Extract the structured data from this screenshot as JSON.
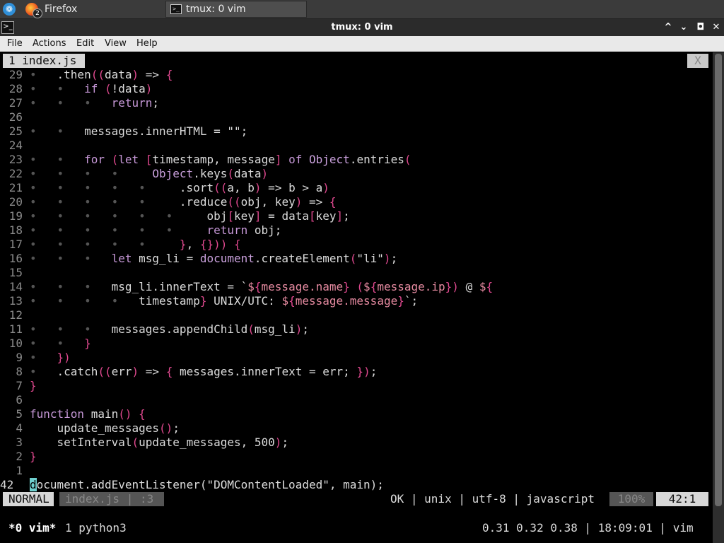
{
  "taskbar": {
    "launcher_glyph": "❁",
    "firefox_badge": "2",
    "firefox_label": "Firefox",
    "tmux_icon": ">_",
    "tmux_label": "tmux: 0 vim"
  },
  "window": {
    "title": "tmux: 0 vim",
    "minimize": "^",
    "restore": "⌄",
    "maximize": "◘",
    "close": "✕"
  },
  "menubar": [
    "File",
    "Actions",
    "Edit",
    "View",
    "Help"
  ],
  "vim": {
    "tab_label": "1 index.js",
    "tab_close": "X",
    "lines": [
      {
        "n": "29",
        "d": "•   ",
        "t": "    .then((data) => {"
      },
      {
        "n": "28",
        "d": "•   •   ",
        "t": "        if (!data)"
      },
      {
        "n": "27",
        "d": "•   •   •   ",
        "t": "            return;"
      },
      {
        "n": "26",
        "d": "",
        "t": ""
      },
      {
        "n": "25",
        "d": "•   •   ",
        "t": "        messages.innerHTML = \"\";"
      },
      {
        "n": "24",
        "d": "",
        "t": ""
      },
      {
        "n": "23",
        "d": "•   •   ",
        "t": "        for (let [timestamp, message] of Object.entries("
      },
      {
        "n": "22",
        "d": "•   •   •   •   ",
        "t": "                  Object.keys(data)"
      },
      {
        "n": "21",
        "d": "•   •   •   •   •   ",
        "t": "                      .sort((a, b) => b > a)"
      },
      {
        "n": "20",
        "d": "•   •   •   •   •   ",
        "t": "                      .reduce((obj, key) => {"
      },
      {
        "n": "19",
        "d": "•   •   •   •   •   •   ",
        "t": "                          obj[key] = data[key];"
      },
      {
        "n": "18",
        "d": "•   •   •   •   •   •   ",
        "t": "                          return obj;"
      },
      {
        "n": "17",
        "d": "•   •   •   •   •   ",
        "t": "                      }, {})) {"
      },
      {
        "n": "16",
        "d": "•   •   •   ",
        "t": "            let msg_li = document.createElement(\"li\");"
      },
      {
        "n": "15",
        "d": "",
        "t": ""
      },
      {
        "n": "14",
        "d": "•   •   •   ",
        "t": "            msg_li.innerText = `${message.name} (${message.ip}) @ ${"
      },
      {
        "n": "13",
        "d": "•   •   •   •   ",
        "t": "                timestamp} UNIX/UTC: ${message.message}`;"
      },
      {
        "n": "12",
        "d": "",
        "t": ""
      },
      {
        "n": "11",
        "d": "•   •   •   ",
        "t": "            messages.appendChild(msg_li);"
      },
      {
        "n": "10",
        "d": "•   •   ",
        "t": "        }"
      },
      {
        "n": "9",
        "d": "•   ",
        "t": "    })"
      },
      {
        "n": "8",
        "d": "•   ",
        "t": "    .catch((err) => { messages.innerText = err; });"
      },
      {
        "n": "7",
        "d": "",
        "t": "}"
      },
      {
        "n": "6",
        "d": "",
        "t": ""
      },
      {
        "n": "5",
        "d": "",
        "t": "function main() {"
      },
      {
        "n": "4",
        "d": "",
        "t": "    update_messages();"
      },
      {
        "n": "3",
        "d": "",
        "t": "    setInterval(update_messages, 500);"
      },
      {
        "n": "2",
        "d": "",
        "t": "}"
      },
      {
        "n": "1",
        "d": "",
        "t": ""
      }
    ],
    "current_line": {
      "n": "42",
      "cursor_char": "d",
      "rest": "ocument.addEventListener(\"DOMContentLoaded\", main);"
    },
    "status": {
      "mode": "NORMAL",
      "file": "index.js  | :3",
      "right": "OK | unix | utf-8 | javascript",
      "percent": "100%",
      "position": "42:1"
    }
  },
  "tmux": {
    "window0": "*0 vim*",
    "window1": "1 python3",
    "right": "0.31 0.32 0.38 | 18:09:01 | vim"
  }
}
